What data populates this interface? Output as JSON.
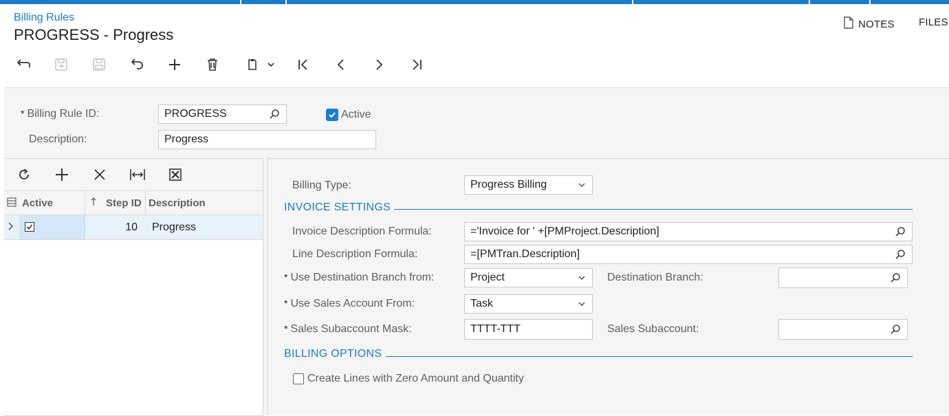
{
  "header": {
    "breadcrumb": "Billing Rules",
    "title": "PROGRESS - Progress",
    "notes_label": "NOTES",
    "files_label": "FILES"
  },
  "toolbar": {
    "buttons": [
      "back-icon",
      "save-close-icon",
      "save-icon",
      "undo-icon",
      "add-icon",
      "delete-icon",
      "copy-paste-icon",
      "first-icon",
      "previous-icon",
      "next-icon",
      "last-icon"
    ]
  },
  "summary": {
    "billing_rule_id_label": "Billing Rule ID:",
    "billing_rule_id_value": "PROGRESS",
    "active_label": "Active",
    "active_checked": true,
    "description_label": "Description:",
    "description_value": "Progress"
  },
  "steps_grid": {
    "columns": [
      "Active",
      "Step ID",
      "Description"
    ],
    "rows": [
      {
        "active": true,
        "step_id": "10",
        "description": "Progress"
      }
    ]
  },
  "details": {
    "billing_type_label": "Billing Type:",
    "billing_type_value": "Progress Billing",
    "invoice_settings_title": "INVOICE SETTINGS",
    "invoice_desc_formula_label": "Invoice Description Formula:",
    "invoice_desc_formula_value": "='Invoice for ' +[PMProject.Description]",
    "line_desc_formula_label": "Line Description Formula:",
    "line_desc_formula_value": "=[PMTran.Description]",
    "dest_branch_from_label": "Use Destination Branch from:",
    "dest_branch_from_value": "Project",
    "dest_branch_label": "Destination Branch:",
    "dest_branch_value": "",
    "sales_account_from_label": "Use Sales Account From:",
    "sales_account_from_value": "Task",
    "sales_subaccount_mask_label": "Sales Subaccount Mask:",
    "sales_subaccount_mask_value": "TTTT-TTT",
    "sales_subaccount_label": "Sales Subaccount:",
    "sales_subaccount_value": "",
    "billing_options_title": "BILLING OPTIONS",
    "zero_amount_label": "Create Lines with Zero Amount and Quantity",
    "zero_amount_checked": false
  },
  "colors": {
    "accent": "#1a7ccb",
    "selected_row": "#e8f2fb",
    "panel_bg": "#f5f5f5"
  }
}
